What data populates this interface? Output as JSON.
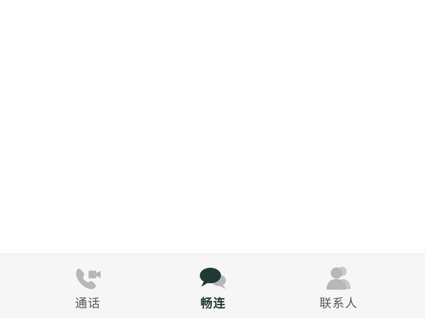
{
  "tabs": [
    {
      "label": "通话",
      "icon": "phone-video-icon",
      "active": false
    },
    {
      "label": "畅连",
      "icon": "chat-bubbles-icon",
      "active": true
    },
    {
      "label": "联系人",
      "icon": "contacts-icon",
      "active": false
    }
  ],
  "colors": {
    "background": "#ffffff",
    "tab_bar_background": "#f6f6f6",
    "active_icon": "#1f3a34",
    "inactive_icon": "#b7b7b7",
    "active_label": "#1f3a34",
    "inactive_label": "#555555"
  }
}
